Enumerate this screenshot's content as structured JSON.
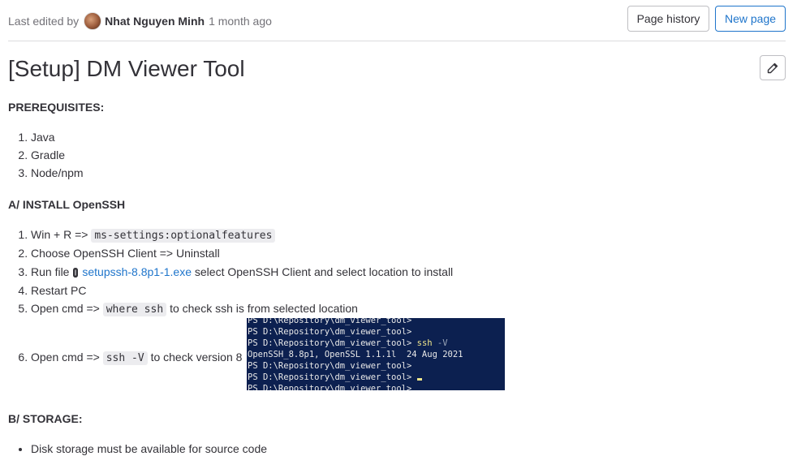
{
  "header": {
    "edited_prefix": "Last edited by",
    "author": "Nhat Nguyen Minh",
    "time_ago": "1 month ago",
    "page_history_label": "Page history",
    "new_page_label": "New page"
  },
  "page": {
    "title": "[Setup] DM Viewer Tool"
  },
  "prerequisites": {
    "heading": "PREREQUISITES:",
    "items": [
      "Java",
      "Gradle",
      "Node/npm"
    ]
  },
  "install": {
    "heading": "A/ INSTALL OpenSSH",
    "step1_text": "Win + R =>",
    "step1_code": "ms-settings:optionalfeatures",
    "step2_text": "Choose OpenSSH Client => Uninstall",
    "step3_prefix": "Run file",
    "step3_link": "setupssh-8.8p1-1.exe",
    "step3_suffix": "select OpenSSH Client and select location to install",
    "step4_text": "Restart PC",
    "step5_prefix": "Open cmd =>",
    "step5_code": "where ssh",
    "step5_suffix": "to check ssh is from selected location",
    "step6_prefix": "Open cmd =>",
    "step6_code": "ssh -V",
    "step6_suffix": "to check version 8"
  },
  "terminal": {
    "line1": "PS D:\\Repository\\dm_viewer_tool>",
    "line2": "PS D:\\Repository\\dm_viewer_tool>",
    "line3_prompt": "PS D:\\Repository\\dm_viewer_tool> ",
    "line3_cmd": "ssh",
    "line3_flag": " -V",
    "line4": "OpenSSH_8.8p1, OpenSSL 1.1.1l  24 Aug 2021",
    "line5": "PS D:\\Repository\\dm_viewer_tool>",
    "line6_prompt": "PS D:\\Repository\\dm_viewer_tool> ",
    "line7": "PS D:\\Repository\\dm_viewer_tool>"
  },
  "storage": {
    "heading": "B/ STORAGE:",
    "items": [
      "Disk storage must be available for source code"
    ]
  },
  "icons": {
    "avatar": "user-avatar",
    "edit": "pencil-icon",
    "attachment": "paperclip-icon"
  },
  "colors": {
    "link": "#1f75cb",
    "terminal_bg": "#0c2050",
    "text": "#333238",
    "muted": "#737278"
  }
}
